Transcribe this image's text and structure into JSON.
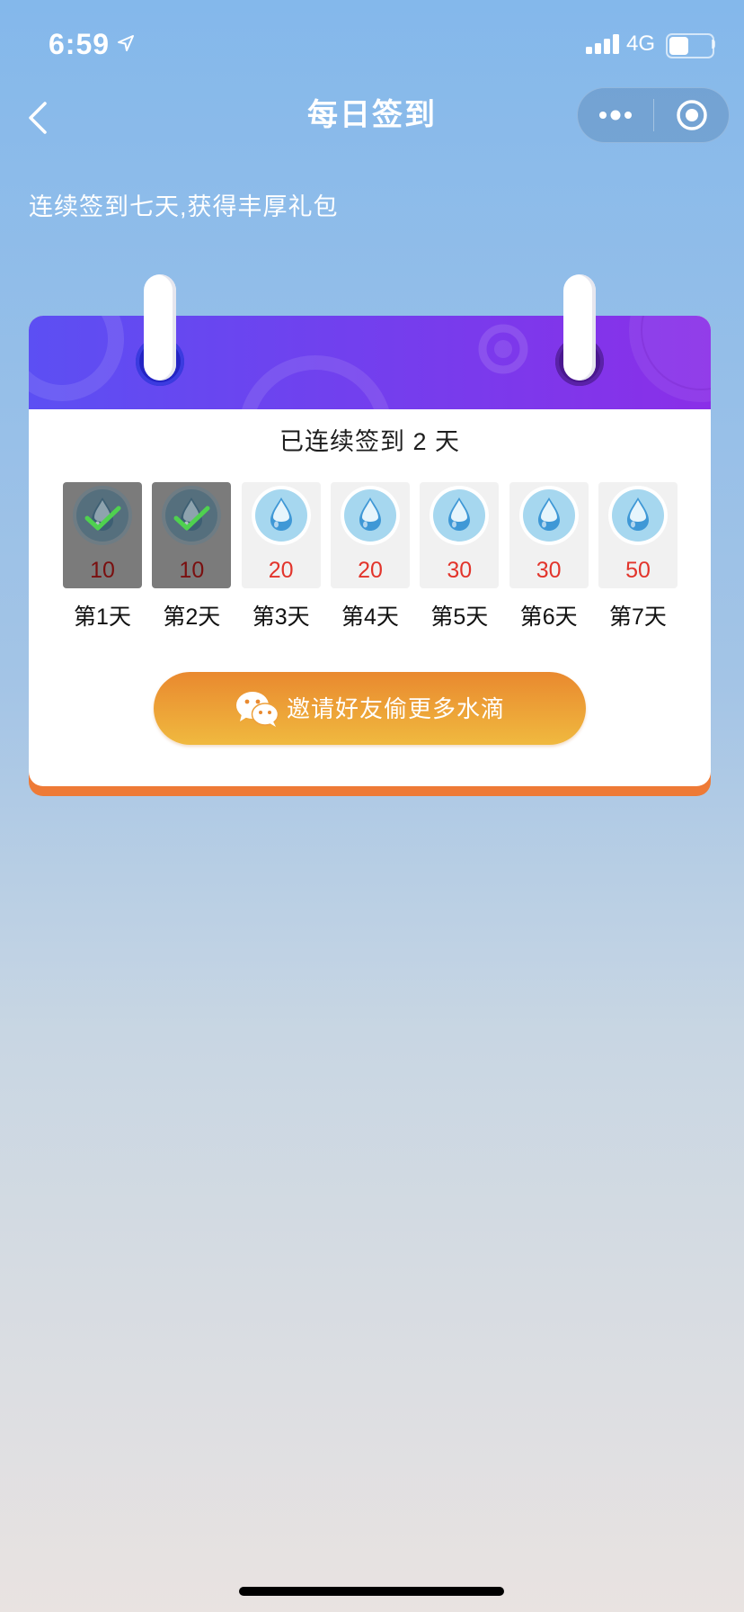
{
  "status_bar": {
    "time": "6:59",
    "network": "4G",
    "battery_level": 0.45,
    "icons": [
      "location-arrow-icon",
      "signal-icon",
      "battery-icon"
    ]
  },
  "nav": {
    "title": "每日签到",
    "back_icon": "chevron-left-icon",
    "capsule_icons": [
      "more-dots-icon",
      "close-target-icon"
    ]
  },
  "subtitle": "连续签到七天,获得丰厚礼包",
  "card": {
    "streak_text": "已连续签到 2 天",
    "days": [
      {
        "label": "第1天",
        "reward": "10",
        "checked": true
      },
      {
        "label": "第2天",
        "reward": "10",
        "checked": true
      },
      {
        "label": "第3天",
        "reward": "20",
        "checked": false
      },
      {
        "label": "第4天",
        "reward": "20",
        "checked": false
      },
      {
        "label": "第5天",
        "reward": "30",
        "checked": false
      },
      {
        "label": "第6天",
        "reward": "30",
        "checked": false
      },
      {
        "label": "第7天",
        "reward": "50",
        "checked": false
      }
    ],
    "reward_icon": "water-drop-icon",
    "checked_icon": "checkmark-icon",
    "invite_button": {
      "label": "邀请好友偷更多水滴",
      "icon": "wechat-icon"
    }
  },
  "colors": {
    "background_top": "#84b8eb",
    "background_bottom": "#e9e3e1",
    "header_start": "#5c4ff3",
    "header_end": "#8a2fe8",
    "reward_red": "#e2342b",
    "checked_tile": "#7b7b7b",
    "check_green": "#4fd14f",
    "button_start": "#e9892f",
    "button_end": "#f0b93f",
    "card_base": "#ee7a36"
  }
}
